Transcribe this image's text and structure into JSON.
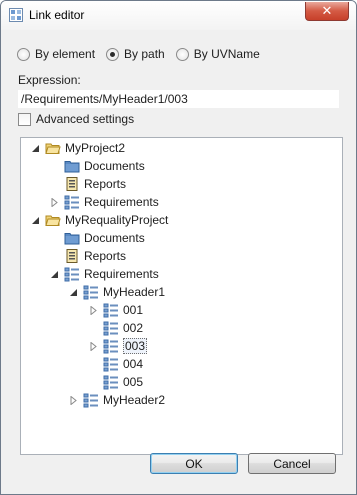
{
  "window": {
    "title": "Link editor",
    "close_label": "✕"
  },
  "mode": {
    "options": [
      {
        "label": "By element",
        "selected": false
      },
      {
        "label": "By path",
        "selected": true
      },
      {
        "label": "By UVName",
        "selected": false
      }
    ]
  },
  "expression": {
    "label": "Expression:",
    "value": "/Requirements/MyHeader1/003"
  },
  "advanced": {
    "label": "Advanced settings",
    "checked": false
  },
  "tree": {
    "nodes": [
      {
        "label": "MyProject2",
        "icon": "folder-open-icon",
        "twisty": "expanded"
      },
      {
        "label": "Documents",
        "icon": "folder-icon",
        "twisty": "none"
      },
      {
        "label": "Reports",
        "icon": "report-icon",
        "twisty": "none"
      },
      {
        "label": "Requirements",
        "icon": "requirements-icon",
        "twisty": "collapsed"
      },
      {
        "label": "MyRequalityProject",
        "icon": "folder-open-icon",
        "twisty": "expanded"
      },
      {
        "label": "Documents",
        "icon": "folder-icon",
        "twisty": "none"
      },
      {
        "label": "Reports",
        "icon": "report-icon",
        "twisty": "none"
      },
      {
        "label": "Requirements",
        "icon": "requirements-icon",
        "twisty": "expanded"
      },
      {
        "label": "MyHeader1",
        "icon": "requirements-icon",
        "twisty": "expanded"
      },
      {
        "label": "001",
        "icon": "requirements-icon",
        "twisty": "collapsed"
      },
      {
        "label": "002",
        "icon": "requirements-icon",
        "twisty": "none"
      },
      {
        "label": "003",
        "icon": "requirements-icon",
        "twisty": "collapsed",
        "selected": true
      },
      {
        "label": "004",
        "icon": "requirements-icon",
        "twisty": "none"
      },
      {
        "label": "005",
        "icon": "requirements-icon",
        "twisty": "none"
      },
      {
        "label": "MyHeader2",
        "icon": "requirements-icon",
        "twisty": "collapsed"
      }
    ]
  },
  "buttons": {
    "ok": "OK",
    "cancel": "Cancel"
  },
  "colors": {
    "folder": "#e8c25a",
    "blue_folder": "#4f7fb8",
    "accent": "#3c7fb1"
  }
}
